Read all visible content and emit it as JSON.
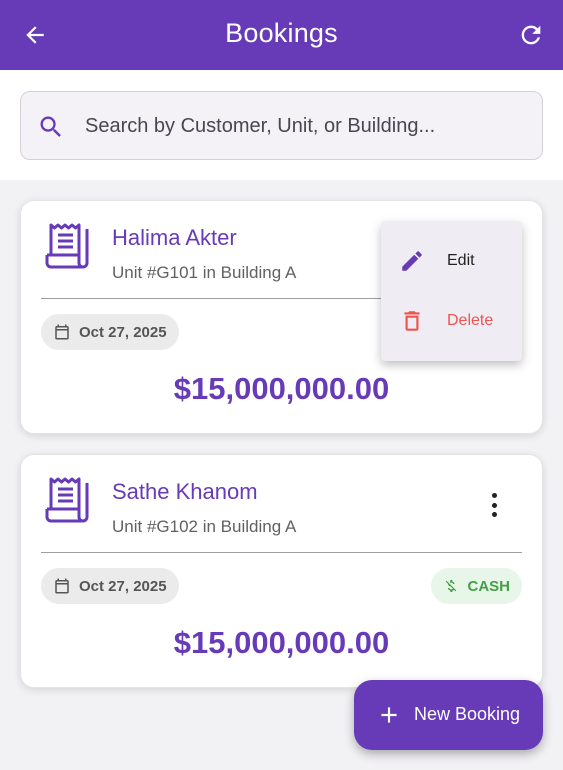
{
  "appbar": {
    "title": "Bookings",
    "back_icon": "arrow-back-icon",
    "refresh_icon": "refresh-icon",
    "color": "#673ab7"
  },
  "search": {
    "placeholder": "Search by Customer, Unit, or Building...",
    "value": "",
    "icon": "search-icon"
  },
  "bookings": [
    {
      "customer": "Halima Akter",
      "unit": "Unit #G101 in Building A",
      "date": "Oct 27, 2025",
      "amount": "$15,000,000.00",
      "payment": "",
      "icon": "receipt-icon"
    },
    {
      "customer": "Sathe Khanom",
      "unit": "Unit #G102 in Building A",
      "date": "Oct 27, 2025",
      "amount": "$15,000,000.00",
      "payment": "CASH",
      "icon": "receipt-icon"
    }
  ],
  "context_menu": {
    "items": [
      {
        "label": "Edit",
        "icon": "pencil-icon",
        "color": "#222222"
      },
      {
        "label": "Delete",
        "icon": "trash-icon",
        "color": "#ef5350"
      }
    ]
  },
  "fab": {
    "label": "New Booking",
    "icon": "plus-icon"
  },
  "colors": {
    "primary": "#673ab7",
    "cash_green": "#43a047",
    "delete_red": "#ef5350"
  }
}
